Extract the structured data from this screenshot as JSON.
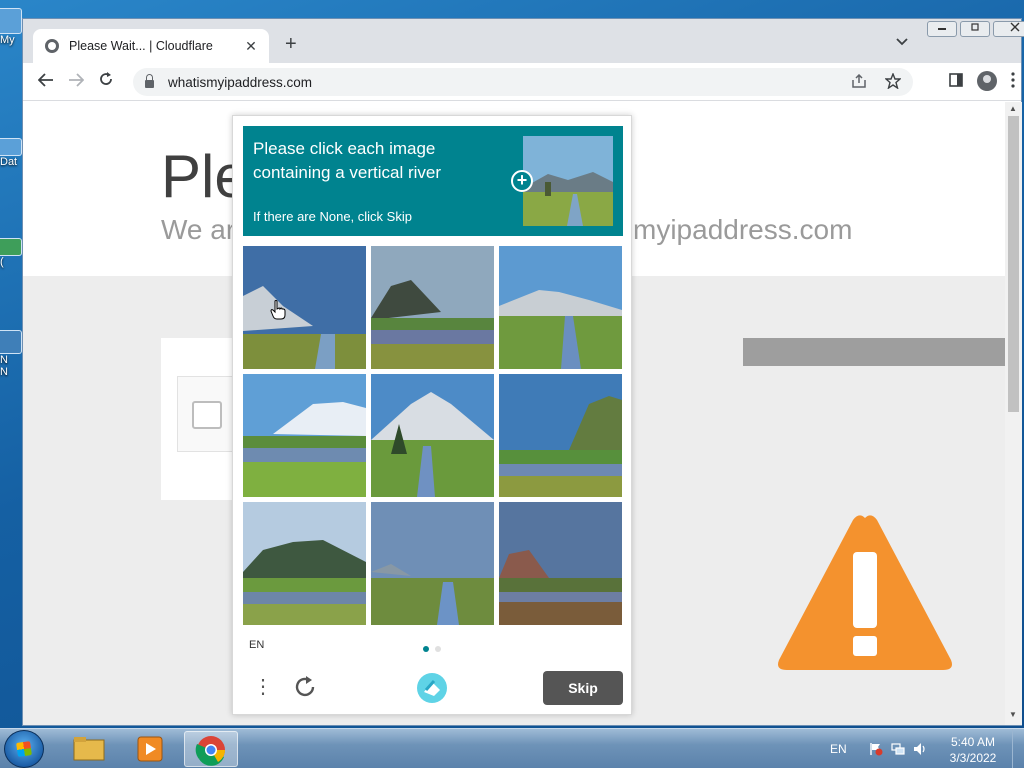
{
  "desktop": {
    "icons": [
      {
        "label": "My"
      },
      {
        "label": "Dat"
      },
      {
        "label": "("
      },
      {
        "label": "N"
      },
      {
        "label": "N"
      }
    ]
  },
  "browser": {
    "tab_title": "Please Wait... | Cloudflare",
    "tab_close": "✕",
    "new_tab": "+",
    "tab_menu": "⌄",
    "window_controls": {
      "minimize": "▭",
      "restore": "❐",
      "close": "✕"
    },
    "url": "whatismyipaddress.com"
  },
  "page": {
    "heading": "Ple",
    "subheading_left": "We ar",
    "subheading_right": "smyipaddress.com"
  },
  "captcha": {
    "prompt": "Please click each image containing a vertical river",
    "sub_prompt": "If there are None, click Skip",
    "language": "EN",
    "skip_label": "Skip",
    "menu_glyph": "⋮",
    "page_count": 2,
    "active_page": 1,
    "accent_color": "#00838f",
    "tiles": [
      {
        "id": "tile-1",
        "scene": "mountain-river-right"
      },
      {
        "id": "tile-2",
        "scene": "mountain-lake"
      },
      {
        "id": "tile-3",
        "scene": "mountain-vertical-river"
      },
      {
        "id": "tile-4",
        "scene": "snow-peaks-lake"
      },
      {
        "id": "tile-5",
        "scene": "peak-vertical-river-tree"
      },
      {
        "id": "tile-6",
        "scene": "cliff-lake"
      },
      {
        "id": "tile-7",
        "scene": "mountain-lake-grass"
      },
      {
        "id": "tile-8",
        "scene": "vertical-river-haze"
      },
      {
        "id": "tile-9",
        "scene": "dusk-lake"
      }
    ]
  },
  "taskbar": {
    "language": "EN",
    "time": "5:40 AM",
    "date": "3/3/2022"
  }
}
